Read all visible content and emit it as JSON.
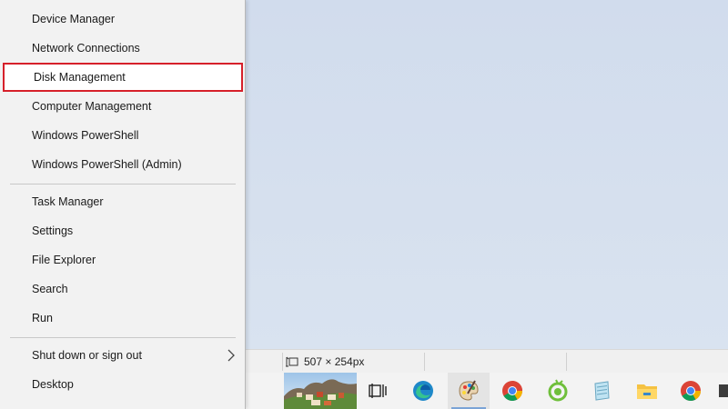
{
  "menu": {
    "items": [
      {
        "label": "Device Manager"
      },
      {
        "label": "Network Connections"
      },
      {
        "label": "Disk Management"
      },
      {
        "label": "Computer Management"
      },
      {
        "label": "Windows PowerShell"
      },
      {
        "label": "Windows PowerShell (Admin)"
      },
      {
        "label": "Task Manager"
      },
      {
        "label": "Settings"
      },
      {
        "label": "File Explorer"
      },
      {
        "label": "Search"
      },
      {
        "label": "Run"
      },
      {
        "label": "Shut down or sign out"
      },
      {
        "label": "Desktop"
      }
    ],
    "highlighted": "Disk Management",
    "highlight_color": "#d6202a"
  },
  "statusbar": {
    "dimensions": "507 × 254px",
    "dimensions_icon": "resize-icon"
  },
  "taskbar": {
    "items": [
      {
        "icon": "landscape-thumbnail-icon"
      },
      {
        "icon": "task-view-icon"
      },
      {
        "icon": "edge-icon"
      },
      {
        "icon": "paint-palette-icon",
        "active": true
      },
      {
        "icon": "chrome-icon"
      },
      {
        "icon": "coccoc-icon"
      },
      {
        "icon": "notepad-icon"
      },
      {
        "icon": "file-explorer-icon"
      },
      {
        "icon": "chrome-icon"
      },
      {
        "icon": "app-icon"
      }
    ]
  },
  "colors": {
    "menu_bg": "#f2f2f2",
    "desktop_bg": "#d3deec",
    "taskbar_bg": "#f3f3f3",
    "accent": "#7aa3d6"
  }
}
